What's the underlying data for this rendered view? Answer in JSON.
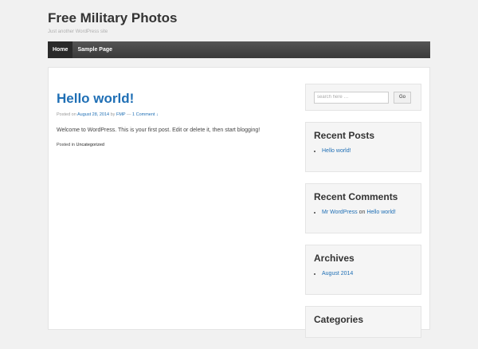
{
  "site": {
    "title": "Free Military Photos",
    "description": "Just another WordPress site"
  },
  "nav": {
    "items": [
      {
        "label": "Home",
        "active": true
      },
      {
        "label": "Sample Page",
        "active": false
      }
    ]
  },
  "post": {
    "title": "Hello world!",
    "meta_posted_on": "Posted on",
    "meta_date": "August 28, 2014",
    "meta_by": "by",
    "meta_author": "FMP",
    "meta_sep": "—",
    "meta_comments": "1 Comment ↓",
    "body": "Welcome to WordPress. This is your first post. Edit or delete it, then start blogging!",
    "footer_label": "Posted in",
    "footer_category": "Uncategorized"
  },
  "sidebar": {
    "search": {
      "placeholder": "search here …",
      "button_label": "Go"
    },
    "recent_posts": {
      "title": "Recent Posts",
      "items": [
        "Hello world!"
      ]
    },
    "recent_comments": {
      "title": "Recent Comments",
      "author": "Mr WordPress",
      "on": "on",
      "post": "Hello world!"
    },
    "archives": {
      "title": "Archives",
      "items": [
        "August 2014"
      ]
    },
    "categories": {
      "title": "Categories"
    }
  }
}
